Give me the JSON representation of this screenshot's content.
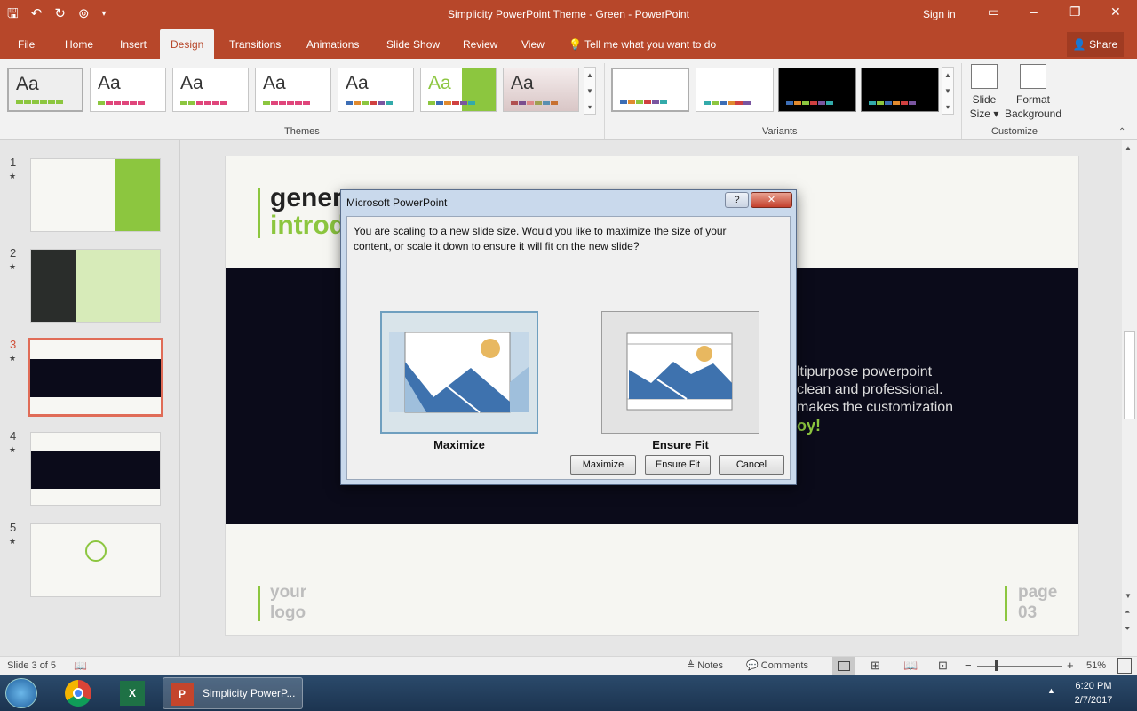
{
  "window": {
    "title": "Simplicity PowerPoint Theme - Green  -  PowerPoint",
    "sign_in": "Sign in"
  },
  "qat": {
    "save_icon": "save-icon",
    "undo_icon": "undo-icon",
    "redo_icon": "redo-icon",
    "present_icon": "present-from-beginning-icon",
    "customize_icon": "customize-qat-icon"
  },
  "tabs": {
    "file": "File",
    "home": "Home",
    "insert": "Insert",
    "design": "Design",
    "transitions": "Transitions",
    "animations": "Animations",
    "slideshow": "Slide Show",
    "review": "Review",
    "view": "View",
    "tellme": "Tell me what you want to do",
    "share": "Share"
  },
  "ribbon": {
    "theme_sample": "Aa",
    "themes_label": "Themes",
    "variants_label": "Variants",
    "customize_label": "Customize",
    "slide_size": "Slide",
    "slide_size_2": "Size",
    "format_background": "Format",
    "format_background_2": "Background"
  },
  "slides": {
    "numbers": [
      "1",
      "2",
      "3",
      "4",
      "5"
    ],
    "star": "★"
  },
  "slide": {
    "title_line1": "gener",
    "title_line2": "introd",
    "body_line1": "ltipurpose powerpoint",
    "body_line2": "clean and professional.",
    "body_line3": "makes the customization",
    "body_line4": "oy!",
    "logo_line1": "your",
    "logo_line2": "logo",
    "page_line1": "page",
    "page_line2": "03"
  },
  "dialog": {
    "title": "Microsoft PowerPoint",
    "help": "?",
    "close": "✕",
    "message_line1": "You are scaling to a new slide size.  Would you like to maximize the size of your",
    "message_line2": "content, or scale it down to ensure it will fit on the new slide?",
    "option_maximize": "Maximize",
    "option_ensure_fit": "Ensure Fit",
    "btn_maximize": "Maximize",
    "btn_ensure_fit": "Ensure Fit",
    "btn_cancel": "Cancel"
  },
  "status": {
    "slide_info": "Slide 3 of 5",
    "notes": "Notes",
    "comments": "Comments",
    "zoom_minus": "−",
    "zoom_plus": "+",
    "zoom": "51%"
  },
  "taskbar": {
    "app_label": "Simplicity PowerP...",
    "time": "6:20 PM",
    "date": "2/7/2017"
  },
  "colors": {
    "accent": "#b7472a",
    "green": "#8cc63f",
    "dark_band": "#0b0b1a"
  }
}
